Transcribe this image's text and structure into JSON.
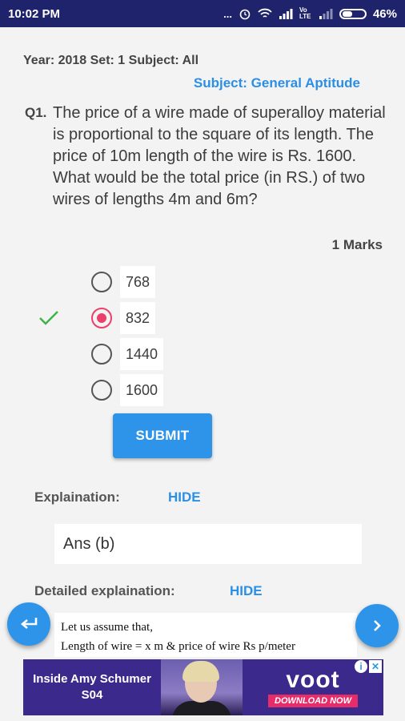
{
  "status_bar": {
    "time": "10:02 PM",
    "dots": "...",
    "net1": "Vo LTE",
    "battery": "46%"
  },
  "question": {
    "meta": "Year: 2018 Set: 1 Subject: All",
    "subject": "Subject:  General Aptitude",
    "number": "Q1.",
    "text": "The price of a wire made of superalloy material is proportional to the square of its length. The price of 10m length of the wire is Rs. 1600. What would be the total price (in RS.) of two wires of lengths 4m and 6m?",
    "marks": "1 Marks"
  },
  "options": [
    {
      "label": "768",
      "selected": false
    },
    {
      "label": "832",
      "selected": true
    },
    {
      "label": "1440",
      "selected": false
    },
    {
      "label": "1600",
      "selected": false
    }
  ],
  "submit_label": "SUBMIT",
  "explanation": {
    "label": "Explaination:",
    "toggle": "HIDE",
    "answer": "Ans (b)"
  },
  "detailed": {
    "label": "Detailed explaination:",
    "toggle": "HIDE",
    "line1": "Let us assume that,",
    "line2": "Length of wire = x m & price of wire Rs p/meter"
  },
  "ad": {
    "title": "Inside Amy Schumer",
    "subtitle": "S04",
    "brand": "voot",
    "cta": "DOWNLOAD NOW"
  },
  "colors": {
    "status_bar": "#1f236b",
    "accent": "#2d94e9",
    "selected": "#ec3f6a",
    "check": "#3cb34a"
  },
  "icons": {
    "prev": "return-arrow-icon",
    "next": "chevron-right-icon",
    "correct": "check-icon"
  }
}
